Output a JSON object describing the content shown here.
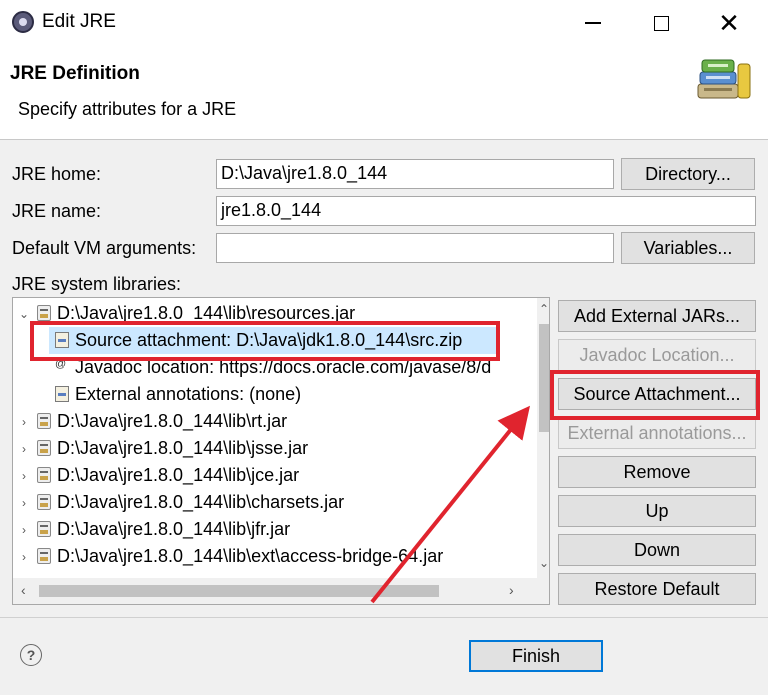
{
  "window": {
    "title": "Edit JRE",
    "minimize_glyph": "",
    "maximize_glyph": "",
    "close_glyph": "✕"
  },
  "header": {
    "title": "JRE Definition",
    "description": "Specify attributes for a JRE"
  },
  "form": {
    "jre_home_label": "JRE home:",
    "jre_home_value": "D:\\Java\\jre1.8.0_144",
    "jre_name_label": "JRE name:",
    "jre_name_value": "jre1.8.0_144",
    "vm_args_label": "Default VM arguments:",
    "vm_args_value": "",
    "libraries_label": "JRE system libraries:",
    "directory_button": "Directory...",
    "variables_button": "Variables..."
  },
  "libraries": [
    {
      "label": "D:\\Java\\jre1.8.0_144\\lib\\resources.jar",
      "expanded": true
    },
    {
      "label": "Source attachment: D:\\Java\\jdk1.8.0_144\\src.zip",
      "child": true,
      "selected": true
    },
    {
      "label": "Javadoc location: https://docs.oracle.com/javase/8/d",
      "child": true
    },
    {
      "label": "External annotations: (none)",
      "child": true
    },
    {
      "label": "D:\\Java\\jre1.8.0_144\\lib\\rt.jar"
    },
    {
      "label": "D:\\Java\\jre1.8.0_144\\lib\\jsse.jar"
    },
    {
      "label": "D:\\Java\\jre1.8.0_144\\lib\\jce.jar"
    },
    {
      "label": "D:\\Java\\jre1.8.0_144\\lib\\charsets.jar"
    },
    {
      "label": "D:\\Java\\jre1.8.0_144\\lib\\jfr.jar"
    },
    {
      "label": "D:\\Java\\jre1.8.0_144\\lib\\ext\\access-bridge-64.jar"
    }
  ],
  "side_buttons": {
    "add_external_jars": "Add External JARs...",
    "javadoc_location": "Javadoc Location...",
    "source_attachment": "Source Attachment...",
    "external_annotations": "External annotations...",
    "remove": "Remove",
    "up": "Up",
    "down": "Down",
    "restore_default": "Restore Default"
  },
  "footer": {
    "finish_button": "Finish",
    "help_glyph": "?"
  },
  "colors": {
    "annotation_red": "#e0242e",
    "selection": "#cce8ff"
  }
}
